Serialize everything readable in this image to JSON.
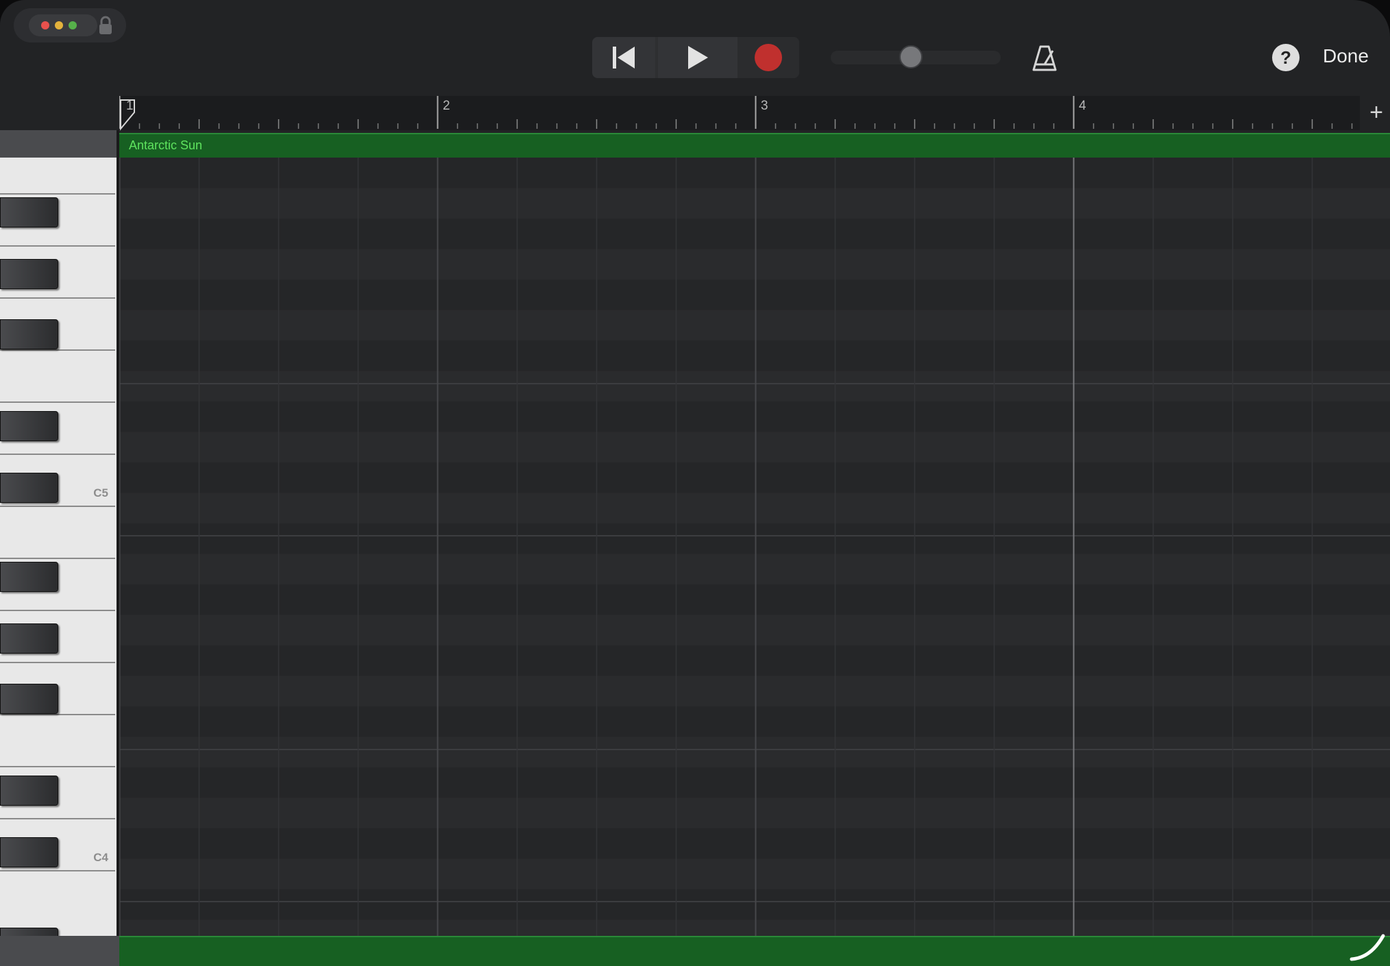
{
  "window_controls": {
    "icons": [
      "close-dot",
      "minimize-dot",
      "zoom-dot",
      "lock-icon"
    ]
  },
  "transport": {
    "icons": [
      "go-to-beginning-icon",
      "play-icon",
      "record-icon"
    ],
    "record_color": "#c0302e"
  },
  "volume": {
    "level": 0.47
  },
  "toolbar": {
    "help_label": "?",
    "done_label": "Done"
  },
  "ruler": {
    "bars": [
      "1",
      "2",
      "3",
      "4"
    ],
    "add_label": "+"
  },
  "region": {
    "name": "Antarctic Sun",
    "color": "#176022",
    "label_color": "#5ee35e"
  },
  "piano": {
    "labels": {
      "c5": "C5",
      "c4": "C4"
    }
  }
}
